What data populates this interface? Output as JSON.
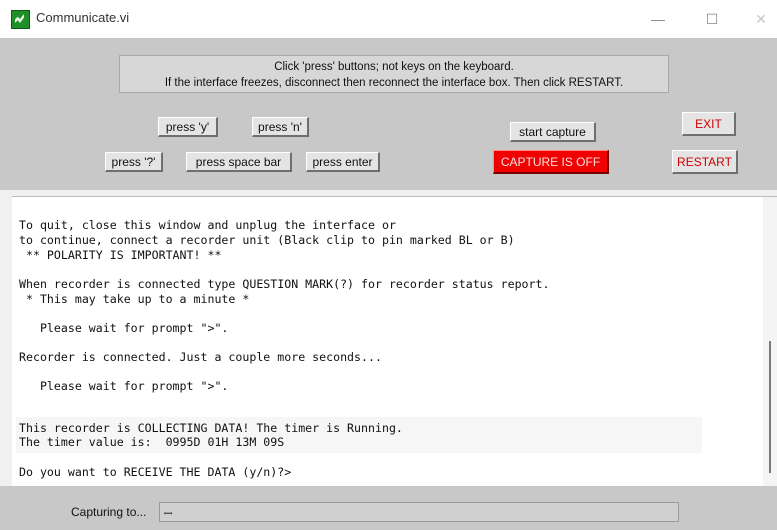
{
  "window": {
    "title": "Communicate.vi",
    "minimize_glyph": "—",
    "maximize_glyph": "☐",
    "close_glyph": "✕"
  },
  "instructions": {
    "line1": "Click 'press' buttons; not keys on the keyboard.",
    "line2": "If the interface freezes, disconnect then reconnect the interface box. Then click RESTART."
  },
  "buttons": {
    "press_y": "press 'y'",
    "press_n": "press 'n'",
    "press_q": "press '?'",
    "press_space": "press space bar",
    "press_enter": "press enter",
    "start_capture": "start capture",
    "capture_status": "CAPTURE IS OFF",
    "exit": "EXIT",
    "restart": "RESTART"
  },
  "terminal": {
    "lines": [
      "To quit, close this window and unplug the interface or",
      "to continue, connect a recorder unit (Black clip to pin marked BL or B)",
      " ** POLARITY IS IMPORTANT! **",
      "When recorder is connected type QUESTION MARK(?) for recorder status report.",
      " * This may take up to a minute *",
      "   Please wait for prompt \">\".",
      "Recorder is connected. Just a couple more seconds...",
      "   Please wait for prompt \">\".",
      "This recorder is COLLECTING DATA! The timer is Running.",
      "The timer value is:  0995D 01H 13M 09S",
      "Do you want to RECEIVE THE DATA (y/n)?>"
    ]
  },
  "capture": {
    "label": "Capturing to...",
    "path_value": ""
  },
  "colors": {
    "panel": "#c8c8c8",
    "capture_off": "#f00000",
    "alert_text": "#d00000"
  }
}
